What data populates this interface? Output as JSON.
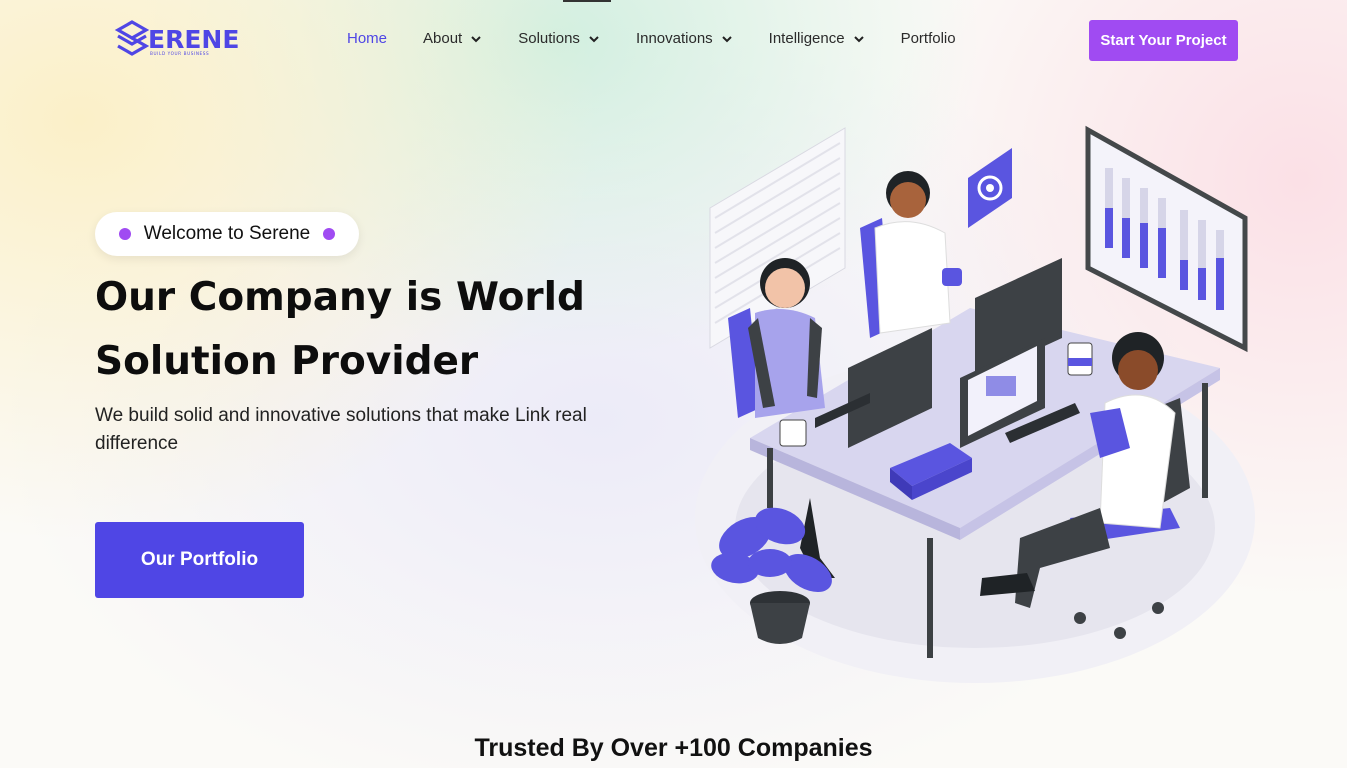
{
  "brand": {
    "logo_text": "SERENE",
    "tagline": "BUILD YOUR BUSINESS",
    "color": "#4f46e5"
  },
  "nav": {
    "items": [
      {
        "label": "Home",
        "active": true,
        "dropdown": false
      },
      {
        "label": "About",
        "active": false,
        "dropdown": true
      },
      {
        "label": "Solutions",
        "active": false,
        "dropdown": true
      },
      {
        "label": "Innovations",
        "active": false,
        "dropdown": true
      },
      {
        "label": "Intelligence",
        "active": false,
        "dropdown": true
      },
      {
        "label": "Portfolio",
        "active": false,
        "dropdown": false
      }
    ],
    "cta_label": "Start Your Project"
  },
  "hero": {
    "badge": "Welcome to Serene",
    "title_line1": "Our Company is World",
    "title_line2": "Solution Provider",
    "subtitle": "We build solid and innovative solutions that make Link real difference",
    "cta_label": "Our Portfolio",
    "illustration": "team-working-at-office-desk-illustration"
  },
  "trusted": {
    "heading": "Trusted By Over +100 Companies"
  },
  "colors": {
    "accent_purple": "#a04bf2",
    "primary_indigo": "#4f46e5",
    "illustration_purple": "#5a55e0"
  }
}
